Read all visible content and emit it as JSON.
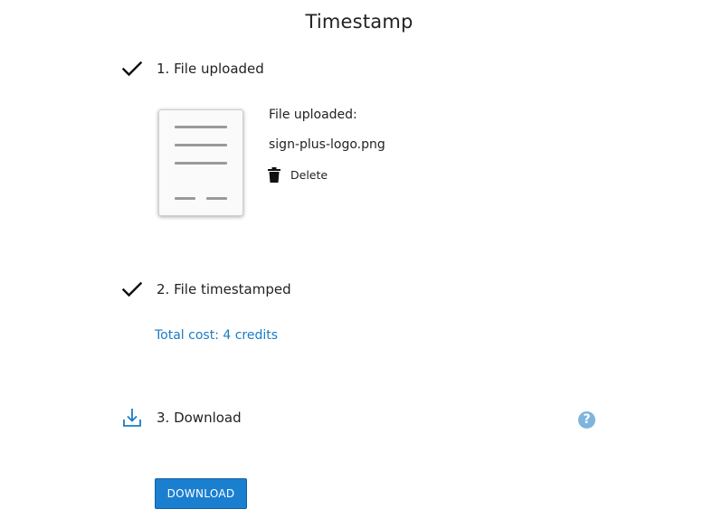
{
  "page": {
    "title": "Timestamp"
  },
  "steps": [
    {
      "number_label": "1. File uploaded",
      "icon": "checkmark-icon"
    },
    {
      "number_label": "2. File timestamped",
      "icon": "checkmark-icon"
    },
    {
      "number_label": "3. Download",
      "icon": "download-icon"
    }
  ],
  "upload": {
    "caption": "File uploaded:",
    "file_name": "sign-plus-logo.png",
    "delete_label": "Delete"
  },
  "timestamp": {
    "cost_text": "Total cost: 4 credits"
  },
  "download": {
    "button_label": "DOWNLOAD",
    "help_glyph": "?"
  },
  "colors": {
    "accent": "#1b7fd0",
    "link": "#1a7cc4",
    "help": "#7fb4dc"
  }
}
